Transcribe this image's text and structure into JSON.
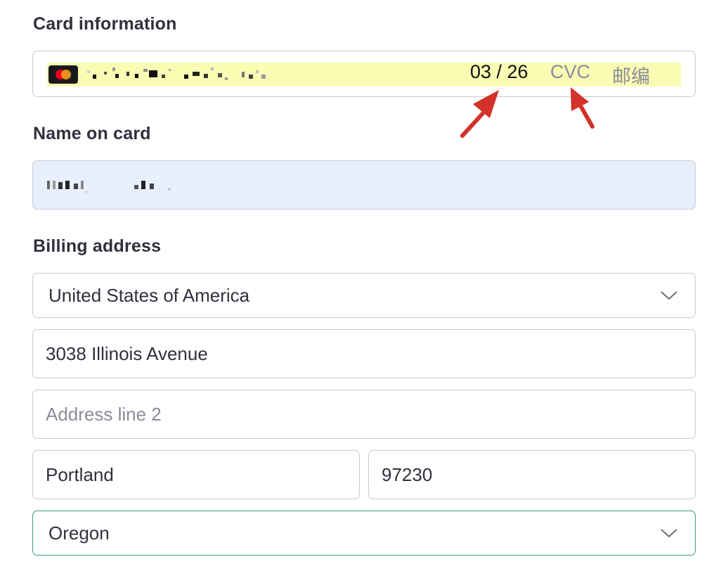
{
  "card_section": {
    "label": "Card information",
    "brand_icon": "mastercard-icon",
    "expiry_value": "03 / 26",
    "cvc_placeholder": "CVC",
    "postal_placeholder": "邮编",
    "autofill_color": "#fafcb4"
  },
  "name_section": {
    "label": "Name on card",
    "autofill_color": "#e8f0fe"
  },
  "billing_section": {
    "label": "Billing address",
    "country_value": "United States of America",
    "line1_value": "3038  Illinois Avenue",
    "line2_placeholder": "Address line 2",
    "city_value": "Portland",
    "zip_value": "97230",
    "state_value": "Oregon",
    "focus_color": "#3f9c7a"
  },
  "annotations": {
    "arrow_color": "#d2322a"
  }
}
